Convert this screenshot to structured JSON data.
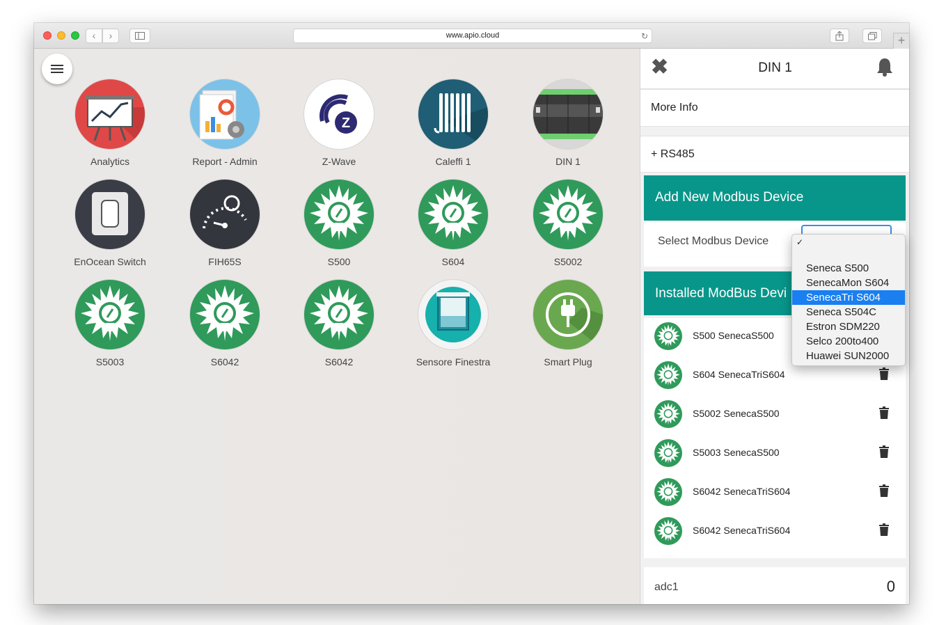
{
  "browser": {
    "url": "www.apio.cloud",
    "back_icon": "chevron-left-icon",
    "forward_icon": "chevron-right-icon",
    "sidebar_icon": "sidebar-icon",
    "share_icon": "share-icon",
    "tabs_icon": "tabs-icon",
    "reload_icon": "reload-icon",
    "new_tab": "+"
  },
  "app": {
    "menu_icon": "hamburger-icon",
    "tiles": [
      {
        "label": "Analytics",
        "icon": "analytics-presentation-icon"
      },
      {
        "label": "Report - Admin",
        "icon": "report-icon"
      },
      {
        "label": "Z-Wave",
        "icon": "zwave-icon"
      },
      {
        "label": "Caleffi 1",
        "icon": "radiator-icon"
      },
      {
        "label": "DIN 1",
        "icon": "din-rail-icon"
      },
      {
        "label": "EnOcean Switch",
        "icon": "light-switch-icon"
      },
      {
        "label": "FIH65S",
        "icon": "gauge-icon"
      },
      {
        "label": "S500",
        "icon": "lightbulb-icon"
      },
      {
        "label": "S604",
        "icon": "lightbulb-icon"
      },
      {
        "label": "S5002",
        "icon": "lightbulb-icon"
      },
      {
        "label": "S5003",
        "icon": "lightbulb-icon"
      },
      {
        "label": "S6042",
        "icon": "lightbulb-icon"
      },
      {
        "label": "S6042",
        "icon": "lightbulb-icon"
      },
      {
        "label": "Sensore Finestra",
        "icon": "window-sensor-icon"
      },
      {
        "label": "Smart Plug",
        "icon": "plug-icon"
      }
    ]
  },
  "panel": {
    "title": "DIN 1",
    "close_icon": "close-icon",
    "bell_icon": "bell-icon",
    "more_info": "More Info",
    "rs485": "+ RS485",
    "add_header": "Add New Modbus Device",
    "select_label": "Select Modbus Device",
    "installed_header": "Installed ModBus Devi",
    "installed": [
      {
        "name": "S500 SenecaS500"
      },
      {
        "name": "S604 SenecaTriS604"
      },
      {
        "name": "S5002 SenecaS500"
      },
      {
        "name": "S5003 SenecaS500"
      },
      {
        "name": "S6042 SenecaTriS604"
      },
      {
        "name": "S6042 SenecaTriS604"
      }
    ],
    "adc_label": "adc1",
    "adc_value": "0"
  },
  "dropdown": {
    "checkmark": "✓",
    "options": [
      "Seneca S500",
      "SenecaMon S604",
      "SenecaTri S604",
      "Seneca S504C",
      "Estron SDM220",
      "Selco 200to400",
      "Huawei SUN2000"
    ],
    "selected": "SenecaTri S604"
  },
  "colors": {
    "teal": "#08968a",
    "green": "#2f9a5a",
    "highlight": "#1a7ff0"
  }
}
